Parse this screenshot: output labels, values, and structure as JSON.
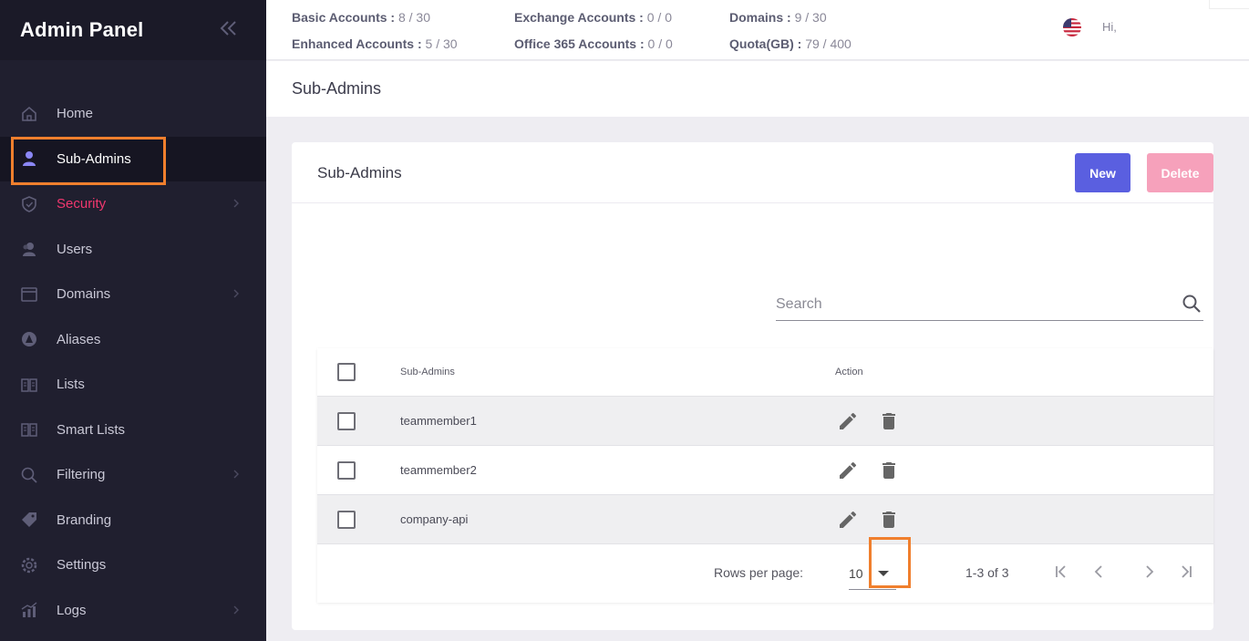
{
  "sidebar": {
    "title": "Admin Panel",
    "items": [
      {
        "label": "Home"
      },
      {
        "label": "Sub-Admins"
      },
      {
        "label": "Security"
      },
      {
        "label": "Users"
      },
      {
        "label": "Domains"
      },
      {
        "label": "Aliases"
      },
      {
        "label": "Lists"
      },
      {
        "label": "Smart Lists"
      },
      {
        "label": "Filtering"
      },
      {
        "label": "Branding"
      },
      {
        "label": "Settings"
      },
      {
        "label": "Logs"
      }
    ]
  },
  "stats": {
    "basic": {
      "label": "Basic Accounts :",
      "value": "8 / 30"
    },
    "enhanced": {
      "label": "Enhanced Accounts :",
      "value": "5 / 30"
    },
    "exchange": {
      "label": "Exchange Accounts :",
      "value": "0 / 0"
    },
    "office": {
      "label": "Office 365 Accounts :",
      "value": "0 / 0"
    },
    "domains": {
      "label": "Domains :",
      "value": "9 / 30"
    },
    "quota": {
      "label": "Quota(GB) :",
      "value": "79 / 400"
    }
  },
  "greeting": "Hi,",
  "page_title": "Sub-Admins",
  "card": {
    "title": "Sub-Admins",
    "new_label": "New",
    "delete_label": "Delete",
    "search_placeholder": "Search"
  },
  "table": {
    "headers": {
      "name": "Sub-Admins",
      "action": "Action"
    },
    "rows": [
      {
        "name": "teammember1"
      },
      {
        "name": "teammember2"
      },
      {
        "name": "company-api"
      }
    ]
  },
  "pagination": {
    "rows_per_page_label": "Rows per page:",
    "rows_per_page": "10",
    "range": "1-3 of 3"
  },
  "colors": {
    "sidebar_bg": "#201f2f",
    "accent": "#5a5fe0",
    "security": "#f1376f",
    "highlight": "#f07f2d"
  }
}
